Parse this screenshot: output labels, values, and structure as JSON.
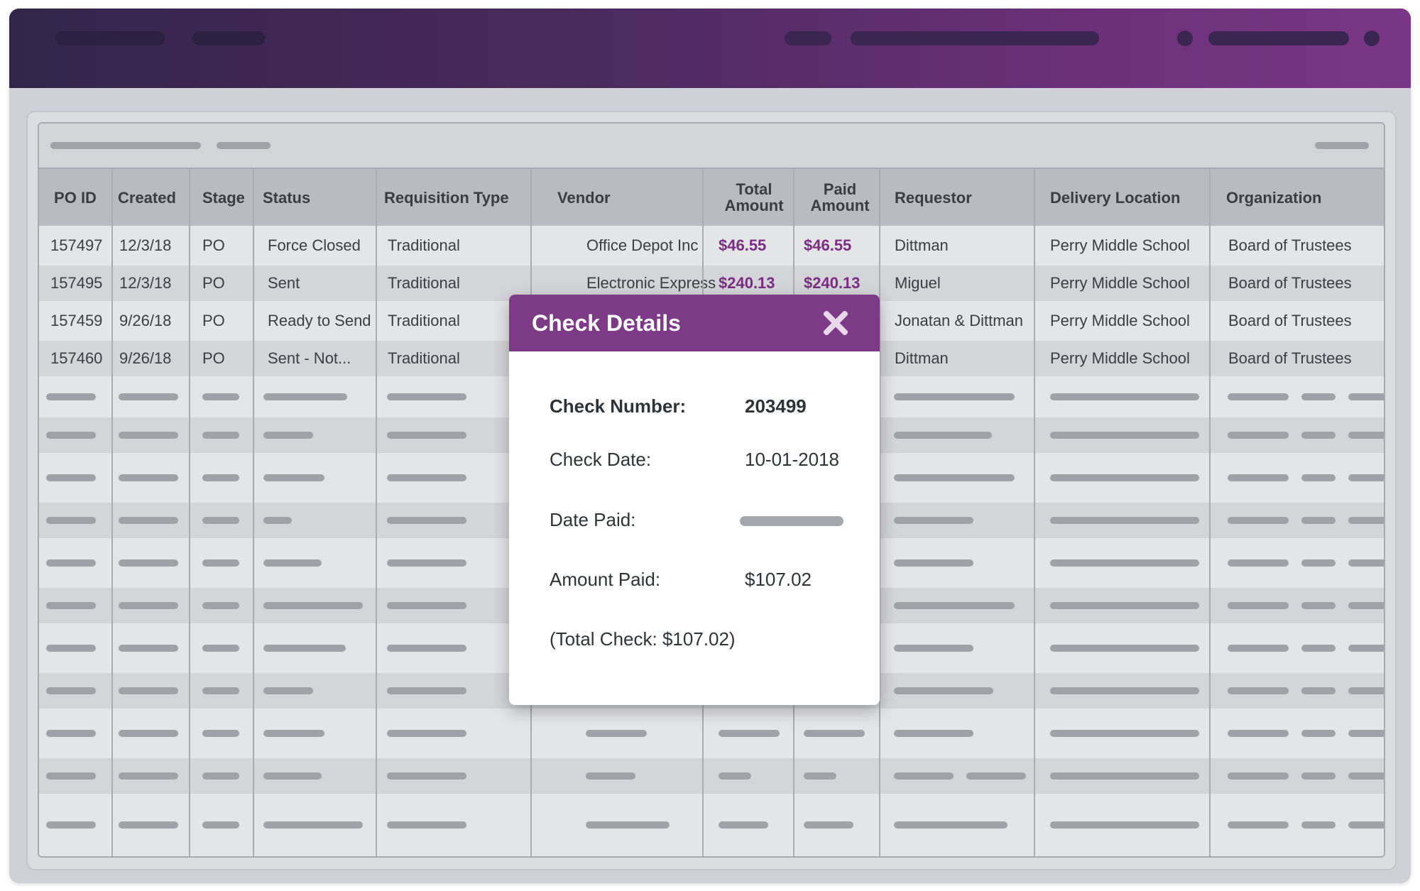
{
  "modal": {
    "title": "Check Details",
    "close_icon": "close-icon",
    "check_number_label": "Check Number:",
    "check_number_value": "203499",
    "check_date_label": "Check Date:",
    "check_date_value": "10-01-2018",
    "date_paid_label": "Date Paid:",
    "amount_paid_label": "Amount Paid:",
    "amount_paid_value": "$107.02",
    "total_check": "(Total Check: $107.02)"
  },
  "table": {
    "headers": [
      "PO ID",
      "Created",
      "Stage",
      "Status",
      "Requisition Type",
      "Vendor",
      "Total Amount",
      "Paid Amount",
      "Requestor",
      "Delivery Location",
      "Organization"
    ],
    "rows": [
      [
        "157497",
        "12/3/18",
        "PO",
        "Force Closed",
        "Traditional",
        "Office Depot Inc",
        "$46.55",
        "$46.55",
        "Dittman",
        "Perry Middle School",
        "Board of Trustees"
      ],
      [
        "157495",
        "12/3/18",
        "PO",
        "Sent",
        "Traditional",
        "Electronic Express",
        "$240.13",
        "$240.13",
        "Miguel",
        "Perry Middle School",
        "Board of Trustees"
      ],
      [
        "157459",
        "9/26/18",
        "PO",
        "Ready to Send",
        "Traditional",
        "",
        "",
        "",
        "Jonatan & Dittman",
        "Perry Middle School",
        "Board of Trustees"
      ],
      [
        "157460",
        "9/26/18",
        "PO",
        "Sent - Not...",
        "Traditional",
        "",
        "",
        "",
        "Dittman",
        "Perry Middle School",
        "Board of Trustees"
      ]
    ]
  },
  "colors": {
    "accent": "#7d3a86",
    "header_gradient_start": "#33254a",
    "header_gradient_end": "#7a3686",
    "money": "#7a2d82"
  }
}
